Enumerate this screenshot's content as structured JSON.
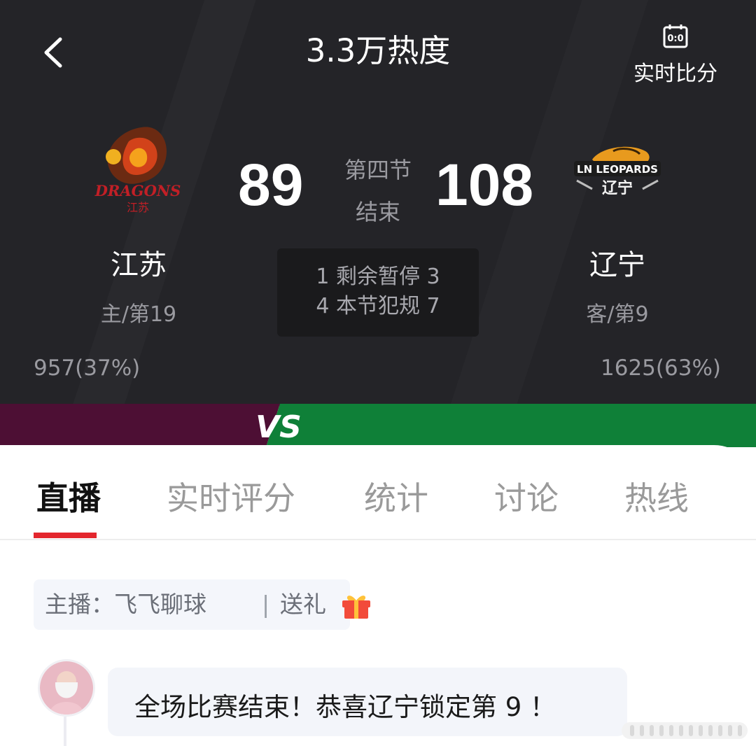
{
  "header": {
    "title": "3.3万热度",
    "live_score_label": "实时比分",
    "live_score_icon_text": "0:0"
  },
  "game": {
    "period": "第四节",
    "status": "结束",
    "home": {
      "name": "江苏",
      "score": "89",
      "rank": "主/第19",
      "support": "957(37%)",
      "support_percent": 37,
      "logo_text": "DRAGONS",
      "color": "#4d0f34"
    },
    "away": {
      "name": "辽宁",
      "score": "108",
      "rank": "客/第9",
      "support": "1625(63%)",
      "support_percent": 63,
      "logo_text": "LN LEOPARDS",
      "color": "#0f8038"
    },
    "timeouts_row": "1 剩余暂停 3",
    "fouls_row": "4 本节犯规 7",
    "vs_text": "VS"
  },
  "tabs": [
    {
      "label": "直播",
      "active": true
    },
    {
      "label": "实时评分",
      "active": false
    },
    {
      "label": "统计",
      "active": false
    },
    {
      "label": "讨论",
      "active": false
    },
    {
      "label": "热线",
      "active": false
    }
  ],
  "anchor": {
    "prefix": "主播：飞飞聊球",
    "separator": "|",
    "gift_label": "送礼"
  },
  "message": {
    "text": "全场比赛结束！恭喜辽宁锁定第 9 ！"
  },
  "colors": {
    "accent": "#e3262d",
    "header_bg": "#242428"
  }
}
